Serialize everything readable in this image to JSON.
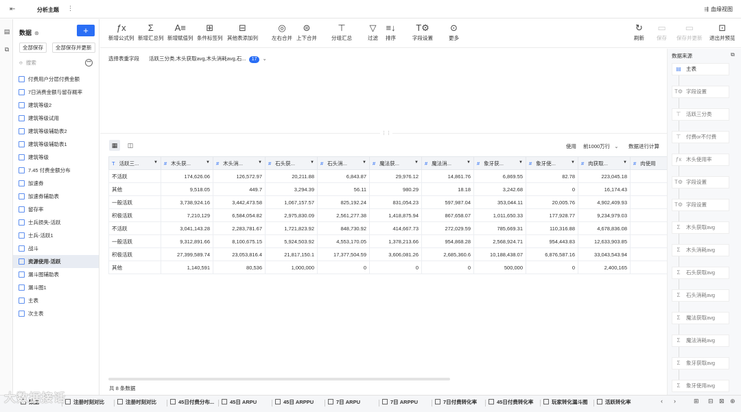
{
  "topbar": {
    "title": "分析主题",
    "lineage": "血缘视图"
  },
  "left": {
    "header": "数据",
    "save_all": "全部保存",
    "save_update": "全部保存并更新",
    "search_placeholder": "搜索",
    "tables": [
      "付费用户分层付费金额",
      "7日消费金额与留存概率",
      "建筑等级2",
      "建筑等级试用",
      "建筑等级辅助表2",
      "建筑等级辅助表1",
      "建筑等级",
      "7.45 付费金额分布",
      "加速券",
      "加速券辅助表",
      "留存率",
      "士兵损失-活跃",
      "士兵-活跃1",
      "战斗",
      "资源使用-活跃",
      "漏斗图辅助表",
      "漏斗图1",
      "主表",
      "次主表"
    ],
    "active_index": 14
  },
  "toolbar": {
    "items": [
      "新增公式列",
      "新增汇总列",
      "新增赋值列",
      "条件标签列",
      "其他表添加列",
      "左右合并",
      "上下合并",
      "分组汇总",
      "过滤",
      "排序",
      "字段设置",
      "更多"
    ],
    "right": [
      "刷新",
      "保存",
      "保存并更新",
      "退出并预览"
    ]
  },
  "fieldrow": {
    "label": "选择表重字段",
    "selected": "活跃三分类,木头获取avg,木头消耗avg,石...",
    "count": "17"
  },
  "grid": {
    "use_label": "使用",
    "rows_option": "前1000万行",
    "calc_label": "数据进行计算",
    "total_rows": "共 8 条数据"
  },
  "table": {
    "columns": [
      "活跃三...",
      "木头获...",
      "木头消...",
      "石头获...",
      "石头消...",
      "魔法获...",
      "魔法消...",
      "象牙获...",
      "象牙使...",
      "肉获取...",
      "肉使用"
    ],
    "rows": [
      [
        "不活跃",
        "174,626.06",
        "126,572.97",
        "20,211.88",
        "6,843.87",
        "29,976.12",
        "14,861.76",
        "6,869.55",
        "82.78",
        "223,045.18",
        "11"
      ],
      [
        "其他",
        "9,518.05",
        "449.7",
        "3,294.39",
        "56.11",
        "980.29",
        "18.18",
        "3,242.68",
        "0",
        "16,174.43",
        ""
      ],
      [
        "一般活跃",
        "3,738,924.16",
        "3,442,473.58",
        "1,067,157.57",
        "825,192.24",
        "831,054.23",
        "597,987.04",
        "353,044.11",
        "20,005.76",
        "4,902,409.93",
        "3,45"
      ],
      [
        "积极活跃",
        "7,210,129",
        "6,584,054.82",
        "2,975,830.09",
        "2,561,277.38",
        "1,418,875.94",
        "867,658.07",
        "1,011,650.33",
        "177,928.77",
        "9,234,979.03",
        "6,51"
      ],
      [
        "不活跃",
        "3,041,143.28",
        "2,283,781.67",
        "1,721,823.92",
        "848,730.92",
        "414,667.73",
        "272,029.59",
        "785,669.31",
        "110,316.88",
        "4,678,836.08",
        "2,40"
      ],
      [
        "一般活跃",
        "9,312,891.66",
        "8,100,675.15",
        "5,924,503.92",
        "4,553,170.05",
        "1,378,213.66",
        "954,868.28",
        "2,568,924.71",
        "954,443.83",
        "12,633,903.85",
        "8,10"
      ],
      [
        "积极活跃",
        "27,399,589.74",
        "23,053,816.4",
        "21,817,150.1",
        "17,377,504.59",
        "3,606,081.26",
        "2,685,360.6",
        "10,188,438.07",
        "6,876,587.16",
        "33,043,543.94",
        "21,35"
      ],
      [
        "其他",
        "1,140,591",
        "80,536",
        "1,000,000",
        "0",
        "0",
        "0",
        "500,000",
        "0",
        "2,400,165",
        ""
      ]
    ]
  },
  "right": {
    "title": "数据来源",
    "nodes": [
      "主表",
      "字段设置",
      "活跃三分类",
      "付费or不付费",
      "木头使用率",
      "字段设置",
      "字段设置",
      "木头获取avg",
      "木头消耗avg",
      "石头获取avg",
      "石头消耗avg",
      "魔法获取avg",
      "魔法消耗avg",
      "象牙获取avg",
      "象牙使用avg"
    ]
  },
  "bottom": {
    "tabs": [
      "数据",
      "注册时刻对比",
      "注册时刻对比",
      "45日付费分布...",
      "45日 ARPU",
      "45日 ARPPU",
      "7日 ARPU",
      "7日 ARPPU",
      "7日付费转化率",
      "45日付费转化率",
      "玩家转化漏斗图",
      "活跃转化率"
    ],
    "watermark": "大数据接话"
  }
}
